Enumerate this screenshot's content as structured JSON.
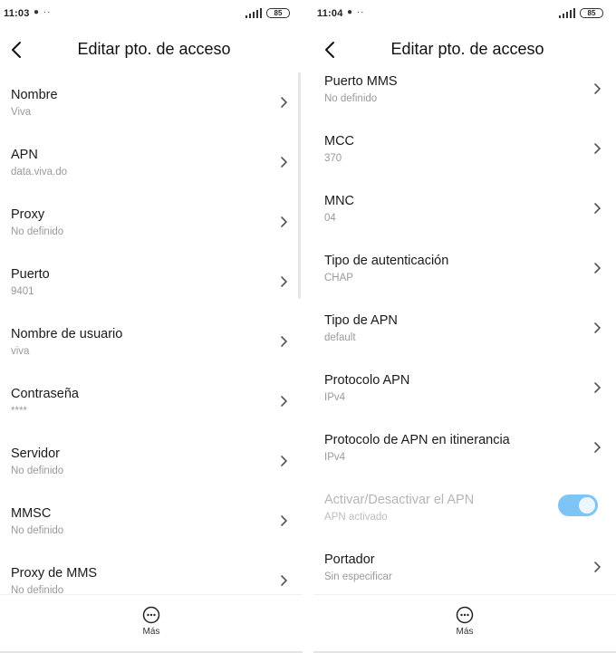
{
  "left": {
    "status": {
      "time": "11:03",
      "icons": "● ··",
      "battery": "85"
    },
    "header": {
      "title": "Editar pto. de acceso"
    },
    "items": [
      {
        "label": "Nombre",
        "value": "Viva"
      },
      {
        "label": "APN",
        "value": "data.viva.do"
      },
      {
        "label": "Proxy",
        "value": "No definido"
      },
      {
        "label": "Puerto",
        "value": "9401"
      },
      {
        "label": "Nombre de usuario",
        "value": "viva"
      },
      {
        "label": "Contraseña",
        "value": "****"
      },
      {
        "label": "Servidor",
        "value": "No definido"
      },
      {
        "label": "MMSC",
        "value": "No definido"
      },
      {
        "label": "Proxy de MMS",
        "value": "No definido"
      }
    ],
    "bottom": {
      "more_label": "Más"
    }
  },
  "right": {
    "status": {
      "time": "11:04",
      "icons": "● ··",
      "battery": "85"
    },
    "header": {
      "title": "Editar pto. de acceso"
    },
    "items": [
      {
        "label": "Puerto MMS",
        "value": "No definido"
      },
      {
        "label": "MCC",
        "value": "370"
      },
      {
        "label": "MNC",
        "value": "04"
      },
      {
        "label": "Tipo de autenticación",
        "value": "CHAP"
      },
      {
        "label": "Tipo de APN",
        "value": "default"
      },
      {
        "label": "Protocolo APN",
        "value": "IPv4"
      },
      {
        "label": "Protocolo de APN en itinerancia",
        "value": "IPv4"
      },
      {
        "label": "Activar/Desactivar el APN",
        "value": "APN activado",
        "toggle": true,
        "on": true
      },
      {
        "label": "Portador",
        "value": "Sin especificar"
      }
    ],
    "bottom": {
      "more_label": "Más"
    }
  },
  "colors": {
    "toggle_on": "#7fc4f6",
    "secondary_text": "#9a9a9a",
    "disabled_text": "#b5b5b5"
  }
}
